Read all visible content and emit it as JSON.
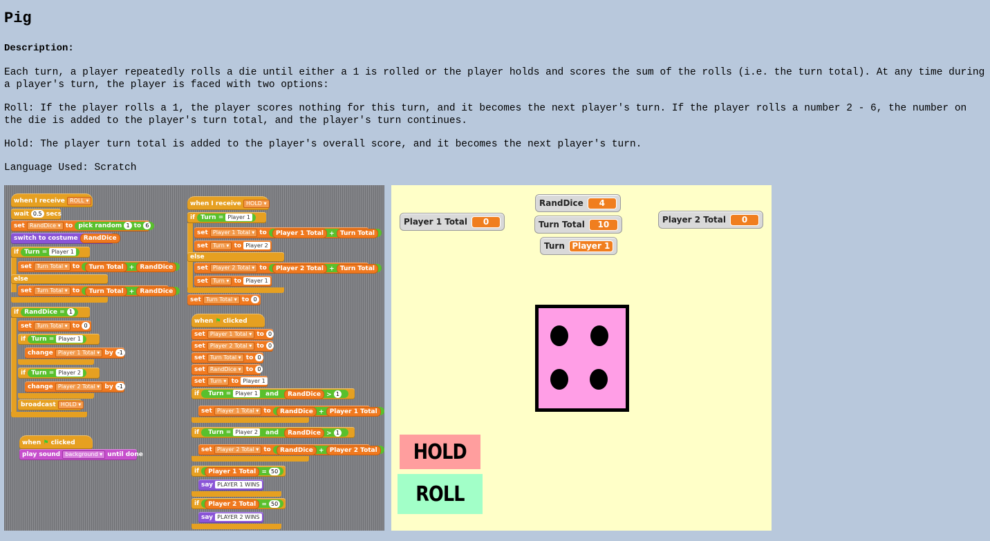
{
  "page": {
    "title": "Pig",
    "description_heading": "Description:",
    "paragraphs": [
      "Each turn, a player repeatedly rolls a die until either a 1 is rolled or the player holds and scores the sum of the rolls (i.e. the turn total). At any time during a player's turn, the player is faced with two options:",
      "Roll: If the player rolls a 1, the player scores nothing for this turn, and it becomes the next player's turn. If the player rolls a number 2 - 6, the number on the die is added to the player's turn total, and the player's turn continues.",
      "Hold: The player turn total is added to the player's overall score, and it becomes the next player's turn.",
      "Language Used: Scratch"
    ]
  },
  "script": {
    "s1": {
      "when_receive": "when I receive",
      "msg_roll": "ROLL",
      "wait": "wait",
      "wait_val": "0.5",
      "secs": "secs",
      "set": "set",
      "randdice": "RandDice",
      "to": "to",
      "pick_random": "pick random",
      "one": "1",
      "six": "6",
      "switch_costume": "switch to costume",
      "if": "if",
      "turn": "Turn",
      "player1": "Player 1",
      "player2": "Player 2",
      "turn_total": "Turn Total",
      "plus": "+",
      "else": "else",
      "zero": "0",
      "change": "change",
      "p1_total": "Player 1 Total",
      "p2_total": "Player 2 Total",
      "by": "by",
      "neg1": "-1",
      "broadcast": "broadcast",
      "msg_hold": "HOLD"
    },
    "s2": {
      "when": "when",
      "clicked": "clicked",
      "play_sound": "play sound",
      "background": "background",
      "until_done": "until done"
    },
    "s3": {
      "when_receive": "when I receive",
      "msg_hold": "HOLD",
      "if": "if",
      "turn": "Turn",
      "player1": "Player 1",
      "player2": "Player 2",
      "set": "set",
      "p1_total": "Player 1 Total",
      "p2_total": "Player 2 Total",
      "to": "to",
      "turn_total": "Turn Total",
      "plus": "+",
      "else": "else",
      "zero": "0"
    },
    "s4": {
      "when": "when",
      "clicked": "clicked",
      "set": "set",
      "to": "to",
      "zero": "0",
      "p1_total": "Player 1 Total",
      "p2_total": "Player 2 Total",
      "turn_total": "Turn Total",
      "randdice": "RandDice",
      "turn": "Turn",
      "player1": "Player 1",
      "player2": "Player 2",
      "if": "if",
      "and": "and",
      "gt": ">",
      "one": "1",
      "plus": "+",
      "eq": "=",
      "fifty": "50",
      "say": "say",
      "p1_wins": "PLAYER 1 WINS",
      "p2_wins": "PLAYER 2 WINS"
    }
  },
  "stage": {
    "monitors": {
      "randdice_label": "RandDice",
      "randdice_value": "4",
      "turn_total_label": "Turn Total",
      "turn_total_value": "10",
      "turn_label": "Turn",
      "turn_value": "Player 1",
      "p1_label": "Player 1 Total",
      "p1_value": "0",
      "p2_label": "Player 2 Total",
      "p2_value": "0"
    },
    "die_face": 4,
    "hold_label": "HOLD",
    "roll_label": "ROLL",
    "colors": {
      "die": "#ff9ee6",
      "hold": "#ff9e9e",
      "roll": "#a2ffc8",
      "stage": "#ffffc8",
      "monitor_value": "#f07e1f"
    }
  }
}
